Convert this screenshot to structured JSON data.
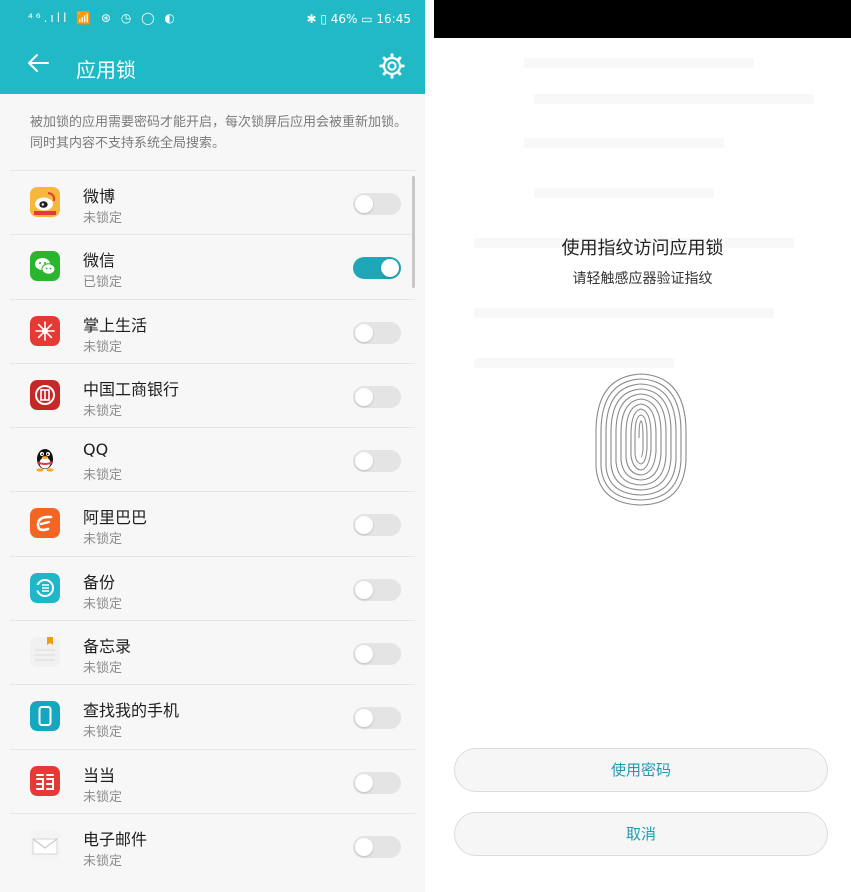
{
  "left": {
    "statusbar": {
      "left": "⁴⁶.ıll 📶 ⊛ ◷ ◯ ◐",
      "right": "✱ ▯ 46% ▭ 16:45"
    },
    "appbar": {
      "title": "应用锁",
      "back_icon": "back-arrow-icon",
      "settings_icon": "gear-icon"
    },
    "description": "被加锁的应用需要密码才能开启，每次锁屏后应用会被重新加锁。同时其内容不支持系统全局搜索。",
    "accent": "#20b9c5",
    "apps": [
      {
        "name": "微博",
        "status": "未锁定",
        "locked": false,
        "icon": "weibo-icon",
        "color": "#f6b73c"
      },
      {
        "name": "微信",
        "status": "已锁定",
        "locked": true,
        "icon": "wechat-icon",
        "color": "#2ab52f"
      },
      {
        "name": "掌上生活",
        "status": "未锁定",
        "locked": false,
        "icon": "zhangshang-shenghuo-icon",
        "color": "#e53935"
      },
      {
        "name": "中国工商银行",
        "status": "未锁定",
        "locked": false,
        "icon": "icbc-icon",
        "color": "#c62828"
      },
      {
        "name": "QQ",
        "status": "未锁定",
        "locked": false,
        "icon": "qq-penguin-icon",
        "color": "#111111"
      },
      {
        "name": "阿里巴巴",
        "status": "未锁定",
        "locked": false,
        "icon": "alibaba-icon",
        "color": "#f26522"
      },
      {
        "name": "备份",
        "status": "未锁定",
        "locked": false,
        "icon": "backup-icon",
        "color": "#1fb6c9"
      },
      {
        "name": "备忘录",
        "status": "未锁定",
        "locked": false,
        "icon": "memo-icon",
        "color": "#f1f1f1"
      },
      {
        "name": "查找我的手机",
        "status": "未锁定",
        "locked": false,
        "icon": "find-phone-icon",
        "color": "#15a6c0"
      },
      {
        "name": "当当",
        "status": "未锁定",
        "locked": false,
        "icon": "dangdang-icon",
        "color": "#e53935"
      },
      {
        "name": "电子邮件",
        "status": "未锁定",
        "locked": false,
        "icon": "email-icon",
        "color": "#f4f4f4"
      }
    ]
  },
  "right": {
    "title": "使用指纹访问应用锁",
    "subtitle": "请轻触感应器验证指纹",
    "fingerprint_icon": "fingerprint-icon",
    "use_password_label": "使用密码",
    "cancel_label": "取消"
  }
}
